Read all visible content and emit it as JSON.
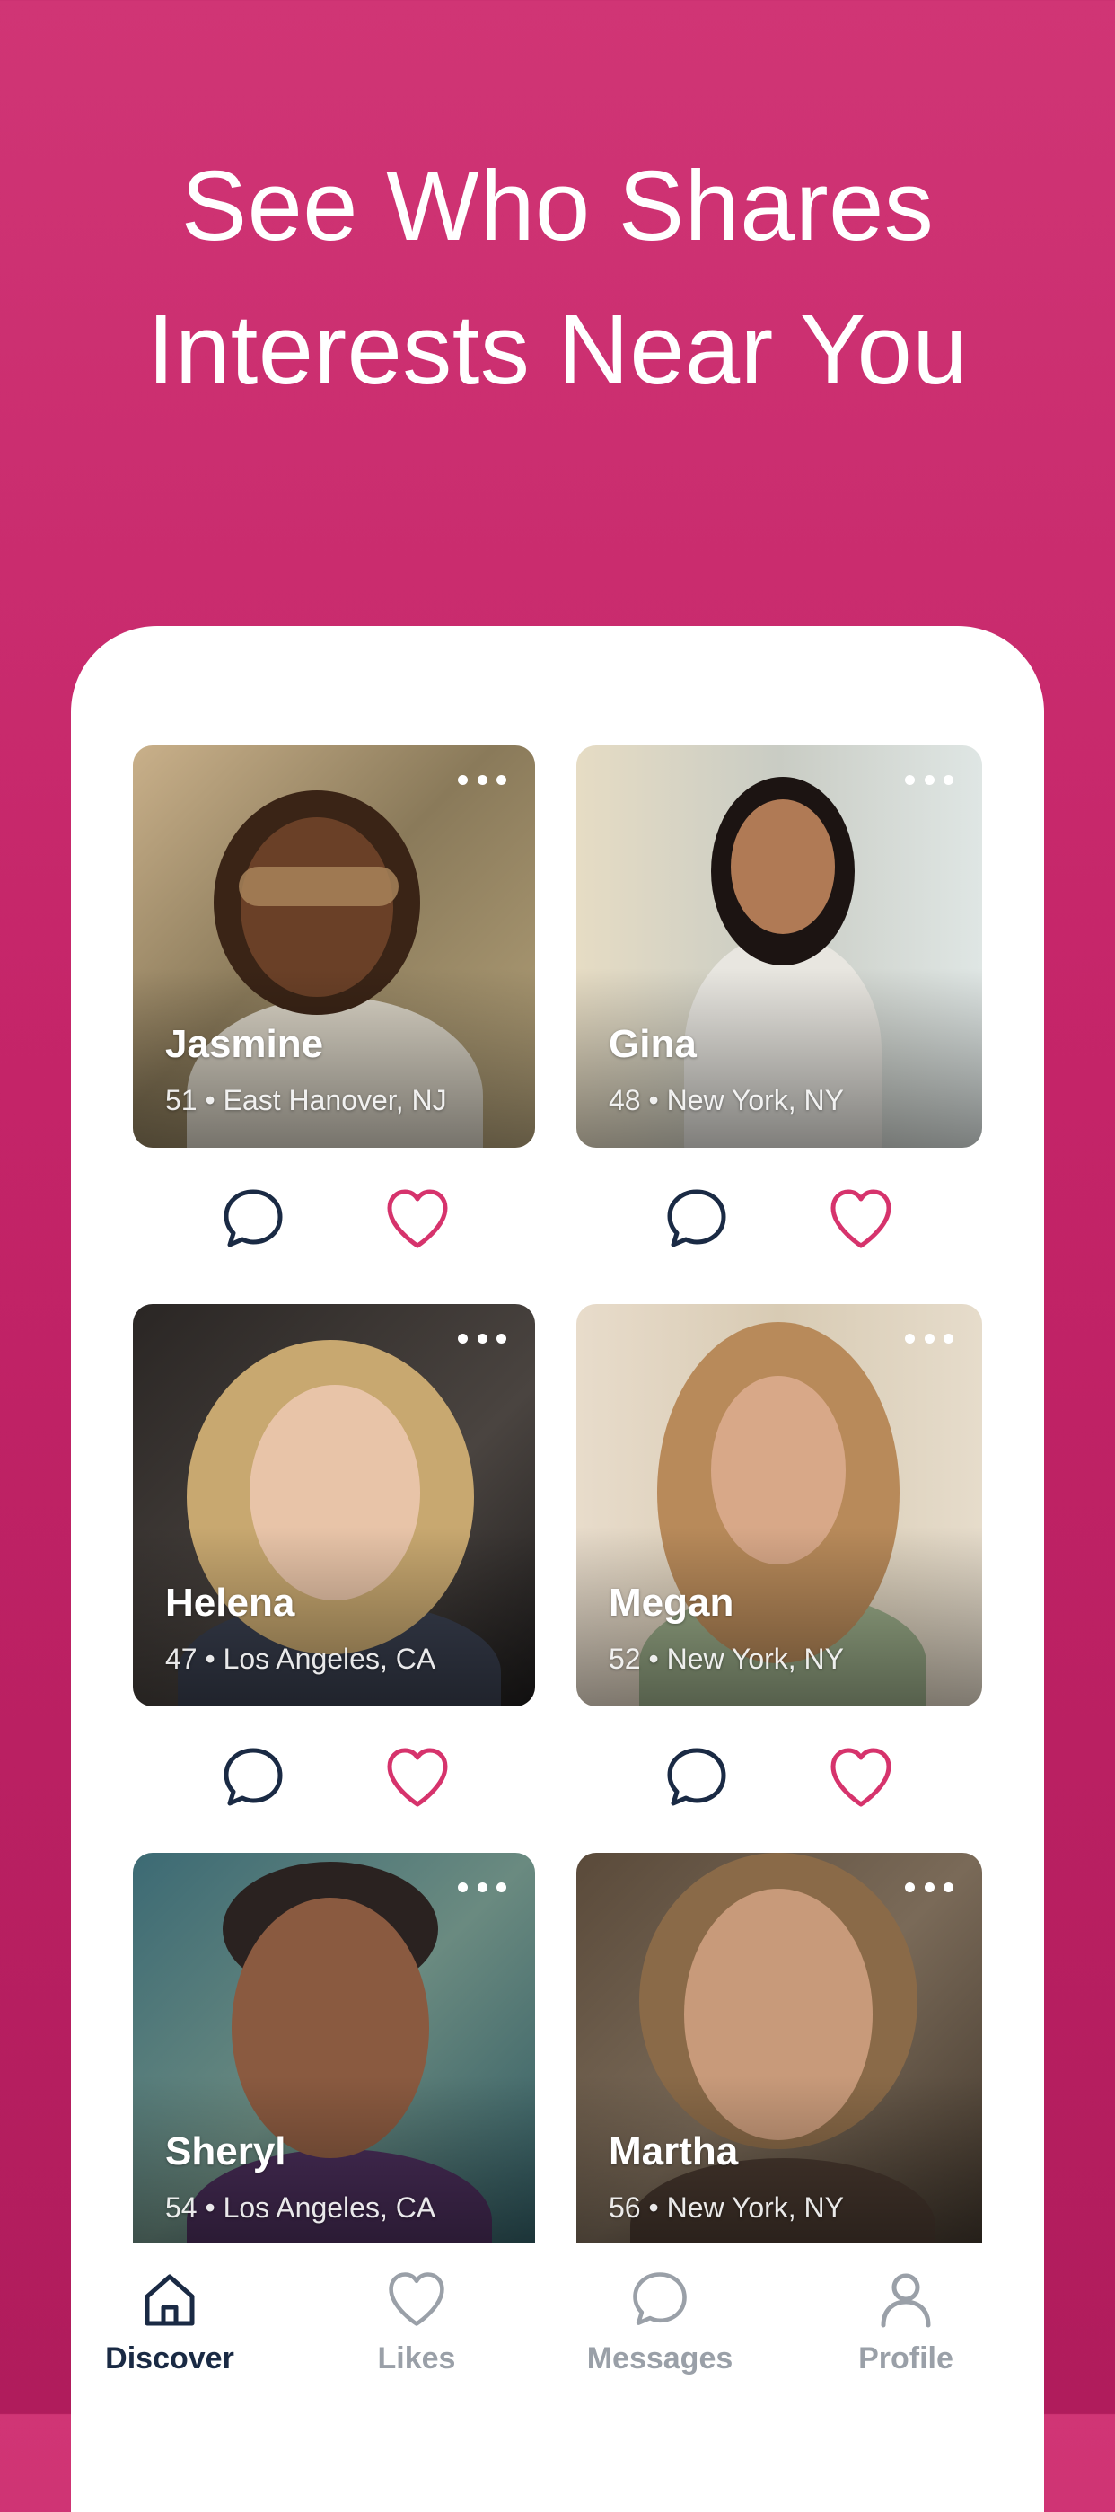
{
  "headline": {
    "line1": "See Who Shares",
    "line2": "Interests Near You"
  },
  "colors": {
    "brand": "#c8276c",
    "navy": "#1a2a44",
    "heart": "#d6336c",
    "muted": "#9aa0a8"
  },
  "profiles": [
    {
      "name": "Jasmine",
      "meta": "51 • East Hanover, NJ"
    },
    {
      "name": "Gina",
      "meta": "48 • New York, NY"
    },
    {
      "name": "Helena",
      "meta": "47 • Los Angeles, CA"
    },
    {
      "name": "Megan",
      "meta": "52 • New York, NY"
    },
    {
      "name": "Sheryl",
      "meta": "54 • Los Angeles, CA"
    },
    {
      "name": "Martha",
      "meta": "56 • New York, NY"
    }
  ],
  "tabs": [
    {
      "label": "Discover",
      "icon": "home-icon",
      "active": true
    },
    {
      "label": "Likes",
      "icon": "heart-icon",
      "active": false
    },
    {
      "label": "Messages",
      "icon": "chat-bubble-icon",
      "active": false
    },
    {
      "label": "Profile",
      "icon": "person-icon",
      "active": false
    }
  ]
}
